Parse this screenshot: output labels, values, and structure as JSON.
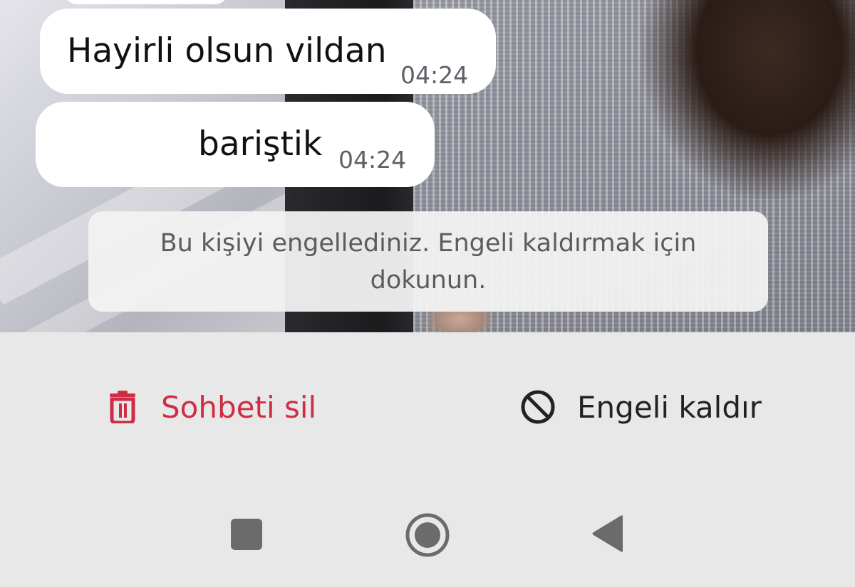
{
  "messages": [
    {
      "text": "Hayirli olsun vildan",
      "time": "04:24"
    },
    {
      "text": "bariştik",
      "time": "04:24"
    }
  ],
  "notice": {
    "line1": "Bu kişiyi engellediniz. Engeli kaldırmak için",
    "line2": "dokunun."
  },
  "actions": {
    "delete_chat": {
      "label": "Sohbeti sil",
      "icon": "trash-icon",
      "color": "#cf2d44"
    },
    "unblock": {
      "label": "Engeli kaldır",
      "icon": "block-icon",
      "color": "#222222"
    }
  },
  "nav": {
    "recents_icon": "square-icon",
    "home_icon": "circle-icon",
    "back_icon": "triangle-back-icon"
  }
}
